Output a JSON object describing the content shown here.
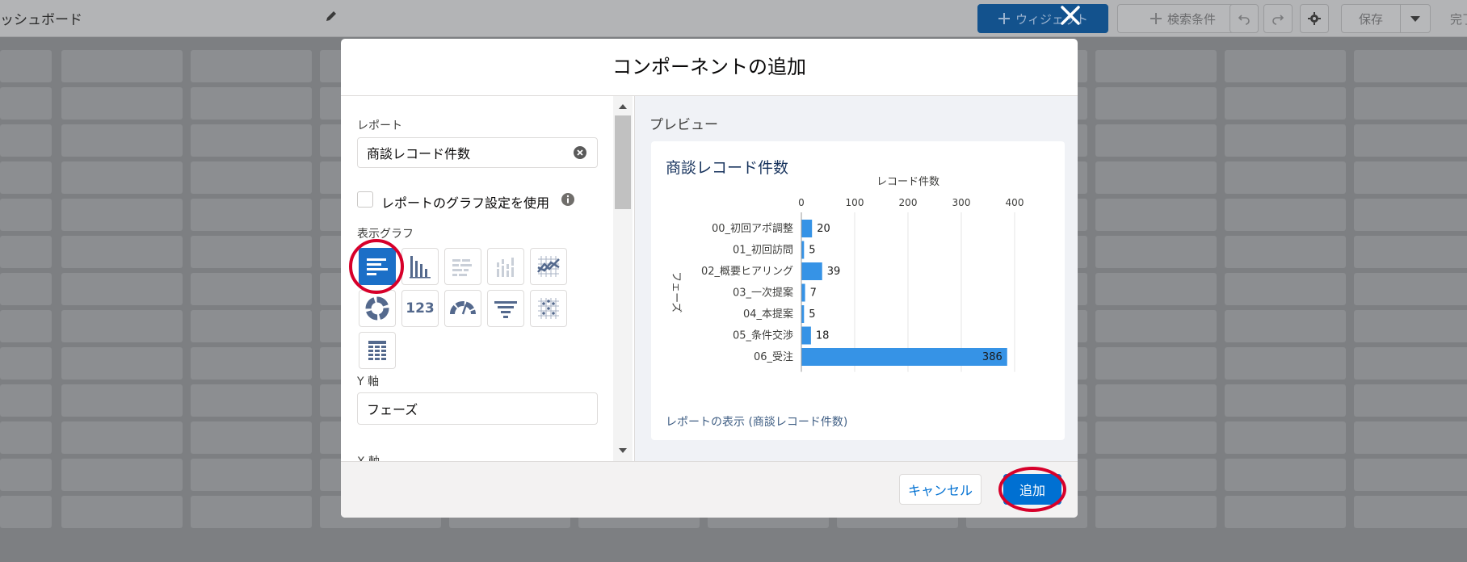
{
  "background": {
    "title": "ッシュボード",
    "toolbar": {
      "add_widget": "ウィジェット",
      "filter": "検索条件",
      "save": "保存",
      "done": "完了"
    }
  },
  "modal": {
    "title": "コンポーネントの追加",
    "report_label": "レポート",
    "report_value": "商談レコード件数",
    "use_report_chart_label": "レポートのグラフ設定を使用",
    "display_chart_label": "表示グラフ",
    "y_axis_label": "Y 軸",
    "y_axis_value": "フェーズ",
    "x_axis_label": "X 軸",
    "chart_types": [
      {
        "id": "horizontal-bar",
        "selected": true
      },
      {
        "id": "vertical-bar",
        "selected": false
      },
      {
        "id": "stacked-horizontal-bar",
        "selected": false
      },
      {
        "id": "stacked-vertical-bar",
        "selected": false
      },
      {
        "id": "line",
        "selected": false
      },
      {
        "id": "donut",
        "selected": false
      },
      {
        "id": "metric",
        "selected": false
      },
      {
        "id": "gauge",
        "selected": false
      },
      {
        "id": "funnel",
        "selected": false
      },
      {
        "id": "scatter",
        "selected": false
      },
      {
        "id": "table",
        "selected": false
      }
    ],
    "metric_text": "123",
    "preview_label": "プレビュー",
    "preview_card_title": "商談レコード件数",
    "view_report_link": "レポートの表示 (商談レコード件数)",
    "cancel_label": "キャンセル",
    "add_label": "追加",
    "colors": {
      "brand": "#0070d2",
      "bar": "#3693e6",
      "highlight_ring": "#d7002a"
    }
  },
  "chart_data": {
    "type": "bar",
    "orientation": "horizontal",
    "title": "",
    "xlabel": "レコード件数",
    "ylabel": "フェーズ",
    "categories": [
      "00_初回アポ調整",
      "01_初回訪問",
      "02_概要ヒアリング",
      "03_一次提案",
      "04_本提案",
      "05_条件交渉",
      "06_受注"
    ],
    "values": [
      20,
      5,
      39,
      7,
      5,
      18,
      386
    ],
    "xlim": [
      0,
      400
    ],
    "xticks": [
      0,
      100,
      200,
      300,
      400
    ],
    "grid": true,
    "color": "#3693e6"
  }
}
